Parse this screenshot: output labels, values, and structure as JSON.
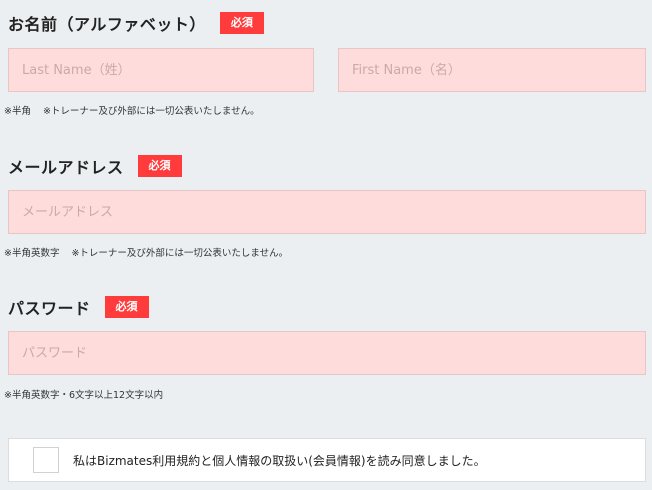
{
  "required_badge": "必須",
  "name_section": {
    "label": "お名前（アルファベット）",
    "last_name_placeholder": "Last Name（姓）",
    "first_name_placeholder": "First Name（名）",
    "note_a": "※半角",
    "note_b": "※トレーナー及び外部には一切公表いたしません。"
  },
  "email_section": {
    "label": "メールアドレス",
    "placeholder": "メールアドレス",
    "note_a": "※半角英数字",
    "note_b": "※トレーナー及び外部には一切公表いたしません。"
  },
  "password_section": {
    "label": "パスワード",
    "placeholder": "パスワード",
    "note": "※半角英数字・6文字以上12文字以内"
  },
  "agreement": {
    "text": "私はBizmates利用規約と個人情報の取扱い(会員情報)を読み同意しました。"
  }
}
